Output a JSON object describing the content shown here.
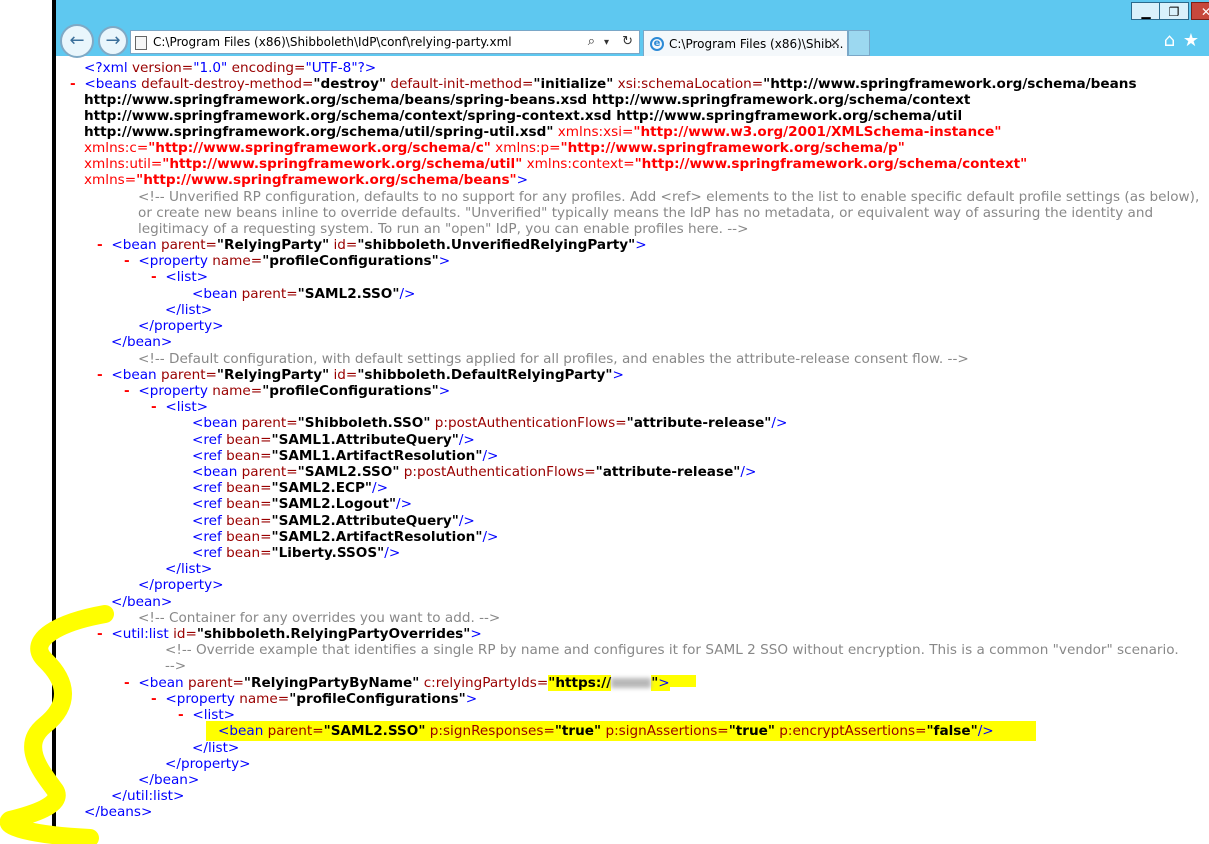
{
  "browser": {
    "address": "C:\\Program Files (x86)\\Shibboleth\\IdP\\conf\\relying-party.xml",
    "tab_title": "C:\\Program Files (x86)\\Shib...",
    "tab_close": "×",
    "min_label": "▁",
    "max_label": "❐",
    "close_label": "✕",
    "back_glyph": "←",
    "forward_glyph": "→",
    "search_glyph": "⌕",
    "dropdown_glyph": "▾",
    "refresh_glyph": "↻",
    "home_glyph": "⌂",
    "star_glyph": "★",
    "favicon_glyph": "e",
    "icons": [
      "back-icon",
      "forward-icon",
      "page-icon",
      "search-icon",
      "dropdown-icon",
      "refresh-icon",
      "ie-icon",
      "close-icon",
      "home-icon",
      "star-icon"
    ]
  },
  "xml": {
    "decl": {
      "open": "<?xml",
      "a1": "version=",
      "v1": "\"1.0\"",
      "a2": "encoding=",
      "v2": "\"UTF-8\"",
      "close": "?>"
    },
    "beans_open": {
      "marker": "-",
      "tag": "<beans",
      "a1": "default-destroy-method=",
      "v1": "\"destroy\"",
      "a2": "default-init-method=",
      "v2": "\"initialize\"",
      "a3": "xsi:schemaLocation=",
      "v3_1": "\"http://www.springframework.org/schema/beans",
      "v3_2": "http://www.springframework.org/schema/beans/spring-beans.xsd http://www.springframework.org/schema/context",
      "v3_3": "http://www.springframework.org/schema/context/spring-context.xsd http://www.springframework.org/schema/util",
      "v3_4": "http://www.springframework.org/schema/util/spring-util.xsd\"",
      "a4": "xmlns:xsi=",
      "v4": "\"http://www.w3.org/2001/XMLSchema-instance\"",
      "a5": "xmlns:c=",
      "v5": "\"http://www.springframework.org/schema/c\"",
      "a6": "xmlns:p=",
      "v6": "\"http://www.springframework.org/schema/p\"",
      "a7": "xmlns:util=",
      "v7": "\"http://www.springframework.org/schema/util\"",
      "a8": "xmlns:context=",
      "v8": "\"http://www.springframework.org/schema/context\"",
      "a9": "xmlns=",
      "v9": "\"http://www.springframework.org/schema/beans\"",
      "close": ">"
    },
    "comment1": {
      "l1": "<!-- Unverified RP configuration, defaults to no support for any profiles. Add <ref> elements to the list to enable specific default profile settings (as below),",
      "l2": "or create new beans inline to override defaults. \"Unverified\" typically means the IdP has no metadata, or equivalent way of assuring the identity and",
      "l3": "legitimacy of a requesting system. To run an \"open\" IdP, you can enable profiles here. -->"
    },
    "bean_unverified": {
      "marker": "-",
      "tag": "<bean",
      "a1": "parent=",
      "v1": "\"RelyingParty\"",
      "a2": "id=",
      "v2": "\"shibboleth.UnverifiedRelyingParty\"",
      "close": ">"
    },
    "prop1": {
      "marker": "-",
      "tag": "<property",
      "a1": "name=",
      "v1": "\"profileConfigurations\"",
      "close": ">"
    },
    "list1": {
      "marker": "-",
      "tag": "<list>"
    },
    "bean_saml2sso_1": {
      "tag": "<bean",
      "a1": "parent=",
      "v1": "\"SAML2.SSO\"",
      "close": "/>"
    },
    "end_list": "</list>",
    "end_property": "</property>",
    "end_bean": "</bean>",
    "comment2": "<!-- Default configuration, with default settings applied for all profiles, and enables the attribute-release consent flow. -->",
    "bean_default": {
      "marker": "-",
      "tag": "<bean",
      "a1": "parent=",
      "v1": "\"RelyingParty\"",
      "a2": "id=",
      "v2": "\"shibboleth.DefaultRelyingParty\"",
      "close": ">"
    },
    "shib_sso": {
      "tag": "<bean",
      "a1": "parent=",
      "v1": "\"Shibboleth.SSO\"",
      "a2": "p:postAuthenticationFlows=",
      "v2": "\"attribute-release\"",
      "close": "/>"
    },
    "refs": [
      {
        "tag": "<ref",
        "a1": "bean=",
        "v1": "\"SAML1.AttributeQuery\"",
        "close": "/>"
      },
      {
        "tag": "<ref",
        "a1": "bean=",
        "v1": "\"SAML1.ArtifactResolution\"",
        "close": "/>"
      }
    ],
    "saml2sso_2": {
      "tag": "<bean",
      "a1": "parent=",
      "v1": "\"SAML2.SSO\"",
      "a2": "p:postAuthenticationFlows=",
      "v2": "\"attribute-release\"",
      "close": "/>"
    },
    "refs2": [
      {
        "tag": "<ref",
        "a1": "bean=",
        "v1": "\"SAML2.ECP\"",
        "close": "/>"
      },
      {
        "tag": "<ref",
        "a1": "bean=",
        "v1": "\"SAML2.Logout\"",
        "close": "/>"
      },
      {
        "tag": "<ref",
        "a1": "bean=",
        "v1": "\"SAML2.AttributeQuery\"",
        "close": "/>"
      },
      {
        "tag": "<ref",
        "a1": "bean=",
        "v1": "\"SAML2.ArtifactResolution\"",
        "close": "/>"
      },
      {
        "tag": "<ref",
        "a1": "bean=",
        "v1": "\"Liberty.SSOS\"",
        "close": "/>"
      }
    ],
    "comment3": "<!-- Container for any overrides you want to add. -->",
    "util_list": {
      "marker": "-",
      "tag": "<util:list",
      "a1": "id=",
      "v1": "\"shibboleth.RelyingPartyOverrides\"",
      "close": ">"
    },
    "comment4": {
      "l1": "<!-- Override example that identifies a single RP by name and configures it for SAML 2 SSO without encryption. This is a common \"vendor\" scenario.",
      "l2": "-->"
    },
    "bean_byname": {
      "marker": "-",
      "tag": "<bean",
      "a1": "parent=",
      "v1": "\"RelyingPartyByName\"",
      "a2": "c:relyingPartyIds=",
      "v2": "\"https://",
      "v2b": "\"",
      "close": ">"
    },
    "saml2sso_3": {
      "tag": "<bean",
      "a1": "parent=",
      "v1": "\"SAML2.SSO\"",
      "a2": "p:signResponses=",
      "v2": "\"true\"",
      "a3": "p:signAssertions=",
      "v3": "\"true\"",
      "a4": "p:encryptAssertions=",
      "v4": "\"false\"",
      "close": "/>"
    },
    "end_util_list": "</util:list>",
    "end_beans": "</beans>"
  }
}
